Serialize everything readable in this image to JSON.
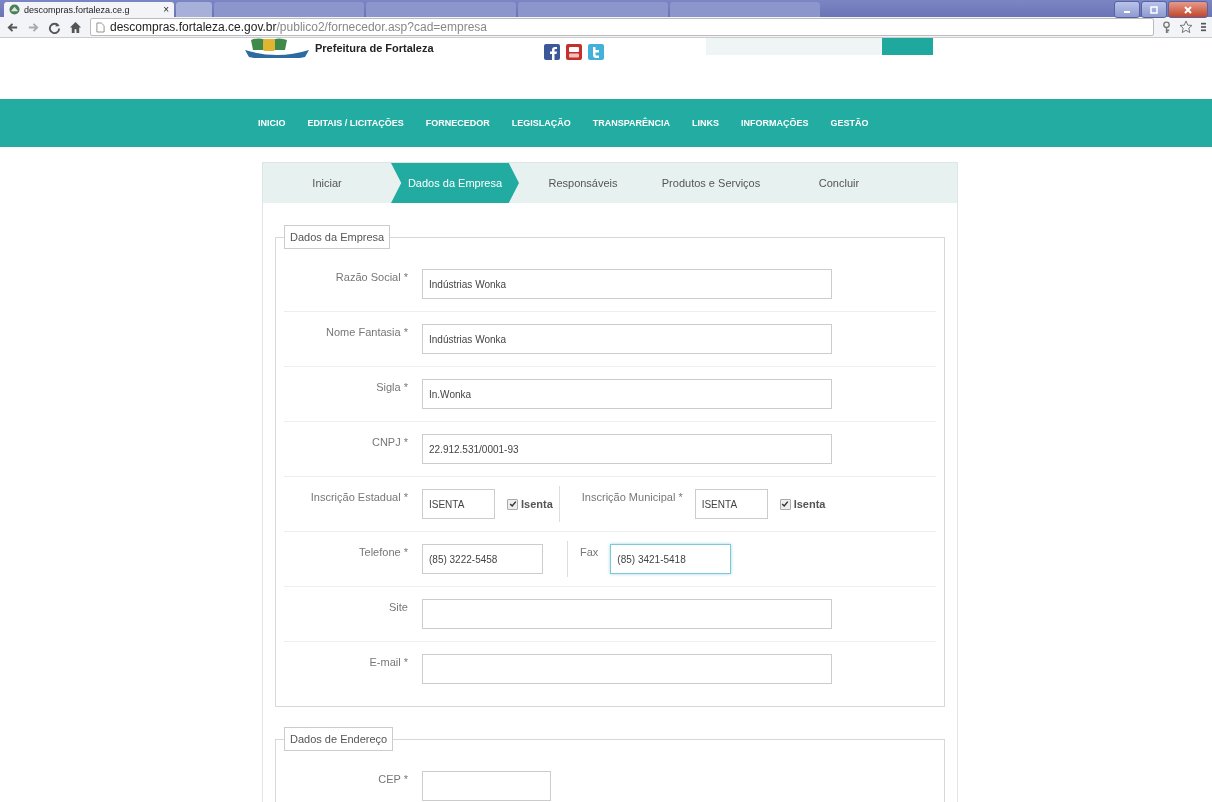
{
  "browser": {
    "tab_title": "descompras.fortaleza.ce.g",
    "tab_close": "×",
    "url_host": "descompras.fortaleza.ce.gov.br",
    "url_path": "/publico2/fornecedor.asp?cad=empresa"
  },
  "header": {
    "site_name": "Prefeitura de Fortaleza"
  },
  "nav": [
    "INICIO",
    "EDITAIS / LICITAÇÕES",
    "FORNECEDOR",
    "LEGISLAÇÃO",
    "TRANSPARÊNCIA",
    "LINKS",
    "INFORMAÇÕES",
    "GESTÃO"
  ],
  "steps": [
    {
      "label": "Iniciar",
      "selected": false
    },
    {
      "label": "Dados da Empresa",
      "selected": true
    },
    {
      "label": "Responsáveis",
      "selected": false
    },
    {
      "label": "Produtos e Serviços",
      "selected": false
    },
    {
      "label": "Concluir",
      "selected": false
    }
  ],
  "sections": [
    {
      "legend": "Dados da Empresa",
      "rows": [
        {
          "kind": "single",
          "fields": [
            {
              "label": "Razão Social *",
              "value": "Indústrias Wonka",
              "focused": false
            }
          ]
        },
        {
          "kind": "single",
          "fields": [
            {
              "label": "Nome Fantasia *",
              "value": "Indústrias Wonka",
              "focused": false
            }
          ]
        },
        {
          "kind": "single",
          "fields": [
            {
              "label": "Sigla *",
              "value": "In.Wonka",
              "focused": false
            }
          ]
        },
        {
          "kind": "single",
          "fields": [
            {
              "label": "CNPJ *",
              "value": "22.912.531/0001-93",
              "focused": false
            }
          ]
        },
        {
          "kind": "exempt",
          "fields": [
            {
              "label": "Inscrição Estadual *",
              "value": "ISENTA",
              "focused": false,
              "check_label": "Isenta",
              "checked": true
            },
            {
              "label": "Inscrição Municipal *",
              "value": "ISENTA",
              "focused": false,
              "check_label": "Isenta",
              "checked": true
            }
          ]
        },
        {
          "kind": "double",
          "fields": [
            {
              "label": "Telefone *",
              "value": "(85) 3222-5458",
              "focused": false
            },
            {
              "label": "Fax",
              "value": "(85) 3421-5418",
              "focused": true
            }
          ]
        },
        {
          "kind": "single",
          "fields": [
            {
              "label": "Site",
              "focused": false
            }
          ]
        },
        {
          "kind": "single",
          "fields": [
            {
              "label": "E-mail *",
              "focused": false
            }
          ]
        }
      ]
    },
    {
      "legend": "Dados de Endereço",
      "rows": [
        {
          "kind": "short",
          "fields": [
            {
              "label": "CEP *",
              "focused": false
            }
          ]
        }
      ]
    }
  ]
}
